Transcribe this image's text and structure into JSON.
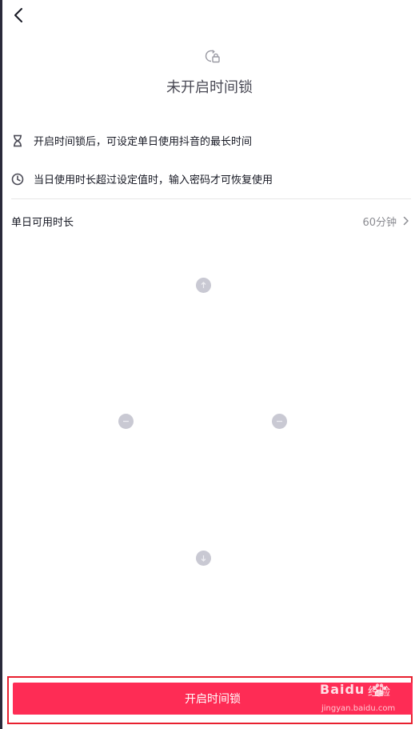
{
  "header": {
    "back_label": ""
  },
  "status": {
    "title": "未开启时间锁"
  },
  "info": {
    "line1": "开启时间锁后，可设定单日使用抖音的最长时间",
    "line2": "当日使用时长超过设定值时，输入密码才可恢复使用"
  },
  "duration": {
    "label": "单日可用时长",
    "value": "60分钟"
  },
  "action": {
    "enable_label": "开启时间锁"
  },
  "watermark": {
    "brand": "Baidu",
    "jingyan": "经验",
    "url": "jingyan.baidu.com"
  },
  "colors": {
    "accent": "#fe2c55",
    "highlight_border": "#e8202f",
    "secondary_text": "#8a8b91"
  },
  "icons": [
    "back-arrow-icon",
    "timer-lock-icon",
    "hourglass-icon",
    "clock-icon",
    "chevron-right-icon",
    "arrow-up-icon",
    "arrow-left-icon",
    "arrow-right-icon",
    "arrow-down-icon"
  ]
}
